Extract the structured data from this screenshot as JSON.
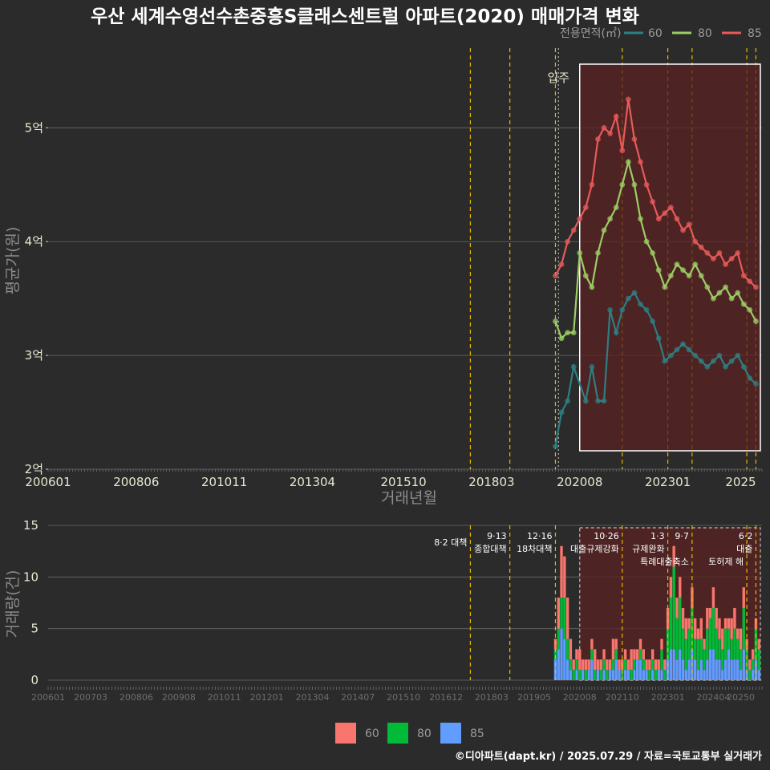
{
  "title": "우산 세계수영선수촌중흥S클래스센트럴 아파트(2020) 매매가격 변화",
  "footer": "©디아파트(dapt.kr) / 2025.07.29 / 자료=국토교통부 실거래가",
  "colors": {
    "background": "#2b2b2b",
    "grid": "#6a6a6a",
    "s60_line": "#2d7f82",
    "s80_line": "#9ccc66",
    "s85_line": "#e85a5a",
    "s60_bar": "#f8766d",
    "s80_bar": "#00ba38",
    "s85_bar": "#619cff",
    "policy_line": "#e6b800",
    "highlight_fill": "#5a2222"
  },
  "price_chart": {
    "ylabel": "평균가(원)",
    "xlabel": "거래년월",
    "ytick_labels": [
      "2억",
      "3억",
      "4억",
      "5억"
    ],
    "ytick_values": [
      2,
      3,
      4,
      5
    ],
    "xtick_labels": [
      "200601",
      "200806",
      "201011",
      "201304",
      "201510",
      "201803",
      "202008",
      "202301",
      "2025"
    ],
    "legend_title": "전용면적(㎡)",
    "legend_items": [
      "60",
      "80",
      "85"
    ],
    "move_in_label": "입주"
  },
  "volume_chart": {
    "ylabel": "거래량(건)",
    "ytick_labels": [
      "0",
      "5",
      "10",
      "15"
    ],
    "ytick_values": [
      0,
      5,
      10,
      15
    ],
    "xtick_labels": [
      "200601",
      "200703",
      "200806",
      "200908",
      "201011",
      "201201",
      "201304",
      "201407",
      "201510",
      "201612",
      "201803",
      "201905",
      "202008",
      "202110",
      "202301",
      "202404",
      "20250"
    ],
    "legend_items": [
      "60",
      "80",
      "85"
    ],
    "policies": [
      {
        "date": "8·2 대책",
        "text": ""
      },
      {
        "date": "9·13",
        "text": "종합대책"
      },
      {
        "date": "12·16",
        "text": "18차대책"
      },
      {
        "date": "10·26",
        "text": "대출규제강화"
      },
      {
        "date": "1·3",
        "text": "규제완화"
      },
      {
        "date": "9·7",
        "text": "특례대출축소"
      },
      {
        "date": "",
        "text": "토허제 해"
      },
      {
        "date": "6·2",
        "text": "대출"
      }
    ]
  },
  "chart_data": [
    {
      "type": "line",
      "title": "우산 세계수영선수촌중흥S클래스센트럴 아파트(2020) 매매가격 변화",
      "xlabel": "거래년월",
      "ylabel": "평균가(원)",
      "ylim": [
        2,
        5.7
      ],
      "unit": "억",
      "x": [
        "201912",
        "202002",
        "202004",
        "202006",
        "202008",
        "202010",
        "202012",
        "202102",
        "202104",
        "202106",
        "202108",
        "202110",
        "202112",
        "202202",
        "202204",
        "202206",
        "202208",
        "202210",
        "202212",
        "202302",
        "202304",
        "202306",
        "202308",
        "202310",
        "202312",
        "202402",
        "202404",
        "202406",
        "202408",
        "202410",
        "202412",
        "202502",
        "202504",
        "202506"
      ],
      "series": [
        {
          "name": "60",
          "values": [
            2.2,
            2.5,
            2.6,
            2.9,
            null,
            2.6,
            2.9,
            2.6,
            2.6,
            3.4,
            3.2,
            3.4,
            3.5,
            3.55,
            3.45,
            3.4,
            3.3,
            3.15,
            2.95,
            3.0,
            3.05,
            3.1,
            3.05,
            3.0,
            2.95,
            2.9,
            2.95,
            3.0,
            2.9,
            2.95,
            3.0,
            2.9,
            2.8,
            2.75
          ]
        },
        {
          "name": "80",
          "values": [
            3.3,
            3.15,
            3.2,
            3.2,
            3.9,
            3.7,
            3.6,
            3.9,
            4.1,
            4.2,
            4.3,
            4.5,
            4.7,
            4.5,
            4.2,
            4.0,
            3.9,
            3.75,
            3.6,
            3.7,
            3.8,
            3.75,
            3.7,
            3.8,
            3.7,
            3.6,
            3.5,
            3.55,
            3.6,
            3.5,
            3.55,
            3.45,
            3.4,
            3.3
          ]
        },
        {
          "name": "85",
          "values": [
            3.7,
            3.8,
            4.0,
            4.1,
            4.2,
            4.3,
            4.5,
            4.9,
            5.0,
            4.95,
            5.1,
            4.8,
            5.25,
            4.9,
            4.7,
            4.5,
            4.35,
            4.2,
            4.25,
            4.3,
            4.2,
            4.1,
            4.15,
            4.0,
            3.95,
            3.9,
            3.85,
            3.9,
            3.8,
            3.85,
            3.9,
            3.7,
            3.65,
            3.6
          ]
        }
      ]
    },
    {
      "type": "bar",
      "title": "",
      "xlabel": "",
      "ylabel": "거래량(건)",
      "ylim": [
        0,
        15
      ],
      "stacked": true,
      "x": [
        "201912",
        "202001",
        "202002",
        "202003",
        "202004",
        "202005",
        "202006",
        "202007",
        "202008",
        "202009",
        "202010",
        "202011",
        "202012",
        "202101",
        "202102",
        "202103",
        "202104",
        "202105",
        "202106",
        "202107",
        "202108",
        "202109",
        "202110",
        "202111",
        "202112",
        "202201",
        "202202",
        "202203",
        "202204",
        "202205",
        "202206",
        "202207",
        "202208",
        "202209",
        "202210",
        "202211",
        "202212",
        "202301",
        "202302",
        "202303",
        "202304",
        "202305",
        "202306",
        "202307",
        "202308",
        "202309",
        "202310",
        "202311",
        "202312",
        "202401",
        "202402",
        "202403",
        "202404",
        "202405",
        "202406",
        "202407",
        "202408",
        "202409",
        "202410",
        "202411",
        "202412",
        "202501",
        "202502",
        "202503",
        "202504",
        "202505",
        "202506",
        "202507"
      ],
      "series": [
        {
          "name": "85",
          "values": [
            2,
            3,
            5,
            4,
            2,
            1,
            0,
            1,
            0,
            1,
            0,
            1,
            2,
            0,
            1,
            0,
            1,
            0,
            1,
            1,
            2,
            1,
            0,
            1,
            1,
            0,
            1,
            2,
            2,
            1,
            1,
            0,
            1,
            0,
            1,
            1,
            0,
            2,
            3,
            3,
            2,
            3,
            2,
            1,
            2,
            3,
            2,
            1,
            2,
            1,
            2,
            3,
            3,
            2,
            2,
            1,
            2,
            3,
            2,
            2,
            2,
            1,
            3,
            1,
            0,
            1,
            2,
            1
          ]
        },
        {
          "name": "80",
          "values": [
            1,
            2,
            3,
            4,
            2,
            1,
            1,
            1,
            1,
            0,
            1,
            0,
            1,
            1,
            0,
            1,
            1,
            1,
            0,
            1,
            1,
            0,
            1,
            1,
            0,
            1,
            1,
            0,
            1,
            1,
            0,
            1,
            1,
            1,
            0,
            2,
            1,
            3,
            5,
            8,
            4,
            5,
            3,
            3,
            3,
            4,
            2,
            3,
            2,
            2,
            3,
            3,
            4,
            3,
            2,
            2,
            3,
            2,
            2,
            3,
            2,
            2,
            4,
            2,
            1,
            1,
            3,
            2
          ]
        },
        {
          "name": "60",
          "values": [
            1,
            3,
            5,
            4,
            4,
            2,
            1,
            1,
            2,
            1,
            1,
            1,
            1,
            2,
            1,
            1,
            1,
            1,
            1,
            2,
            1,
            1,
            1,
            1,
            1,
            2,
            1,
            1,
            1,
            1,
            1,
            1,
            1,
            1,
            1,
            1,
            1,
            2,
            2,
            2,
            2,
            2,
            2,
            2,
            1,
            2,
            2,
            1,
            2,
            1,
            2,
            1,
            2,
            2,
            2,
            2,
            1,
            1,
            2,
            2,
            1,
            2,
            2,
            1,
            1,
            1,
            1,
            1
          ]
        }
      ]
    }
  ]
}
